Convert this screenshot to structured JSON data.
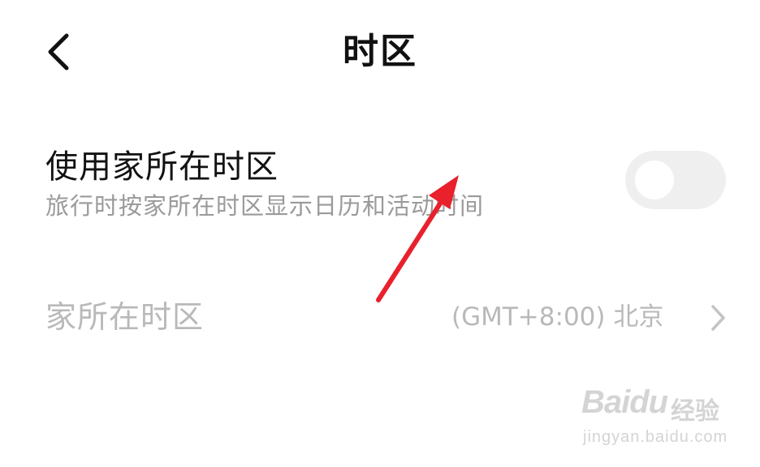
{
  "header": {
    "title": "时区",
    "back_icon": "chevron-left-icon"
  },
  "use_home_timezone": {
    "title": "使用家所在时区",
    "description": "旅行时按家所在时区显示日历和活动时间",
    "enabled": false
  },
  "home_timezone": {
    "label": "家所在时区",
    "value": "(GMT+8:00) 北京",
    "chevron_icon": "chevron-right-icon"
  },
  "annotation": {
    "arrow_color": "#e8212c"
  },
  "watermark": {
    "brand": "Baidu",
    "cn": "经验",
    "url": "jingyan.baidu.com"
  }
}
